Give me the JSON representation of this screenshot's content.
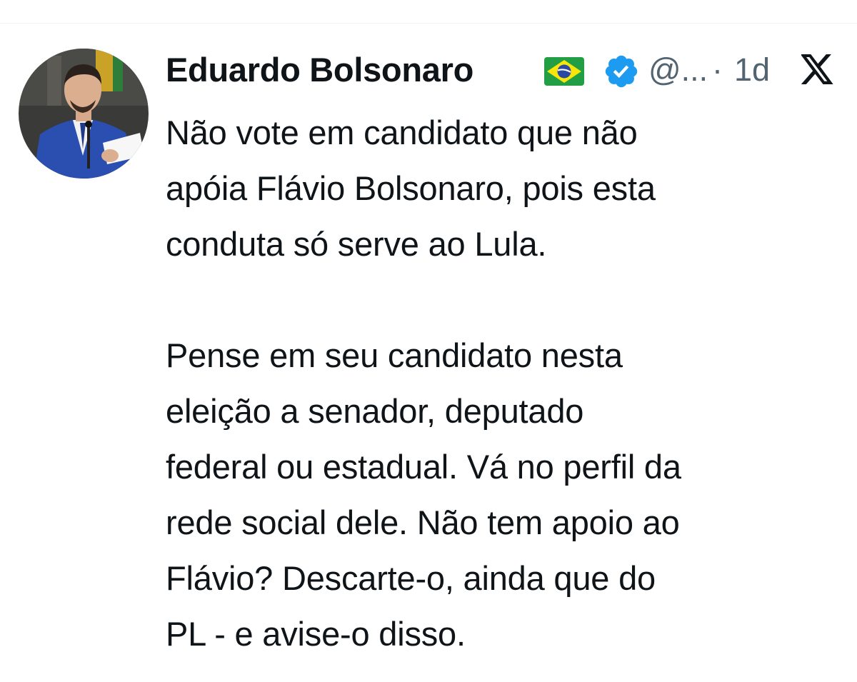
{
  "tweet": {
    "author_name": "Eduardo Bolsonaro",
    "flag_icon": "brazil-flag-icon",
    "verified_icon": "verified-badge-icon",
    "verified_color": "#1d9bf0",
    "handle": "@...",
    "separator": "·",
    "timestamp": "1d",
    "platform_icon": "x-logo-icon",
    "body": {
      "paragraph_1": [
        "Não vote em candidato que não",
        "apóia Flávio Bolsonaro, pois esta",
        "conduta só serve ao Lula."
      ],
      "paragraph_2": [
        "Pense em seu candidato nesta",
        "eleição a senador, deputado",
        "federal ou estadual. Vá no perfil da",
        "rede social dele. Não tem apoio ao",
        "Flávio? Descarte-o, ainda que do",
        "PL - e avise-o disso."
      ]
    }
  },
  "colors": {
    "text_primary": "#0f1419",
    "text_secondary": "#536471",
    "background": "#ffffff"
  }
}
